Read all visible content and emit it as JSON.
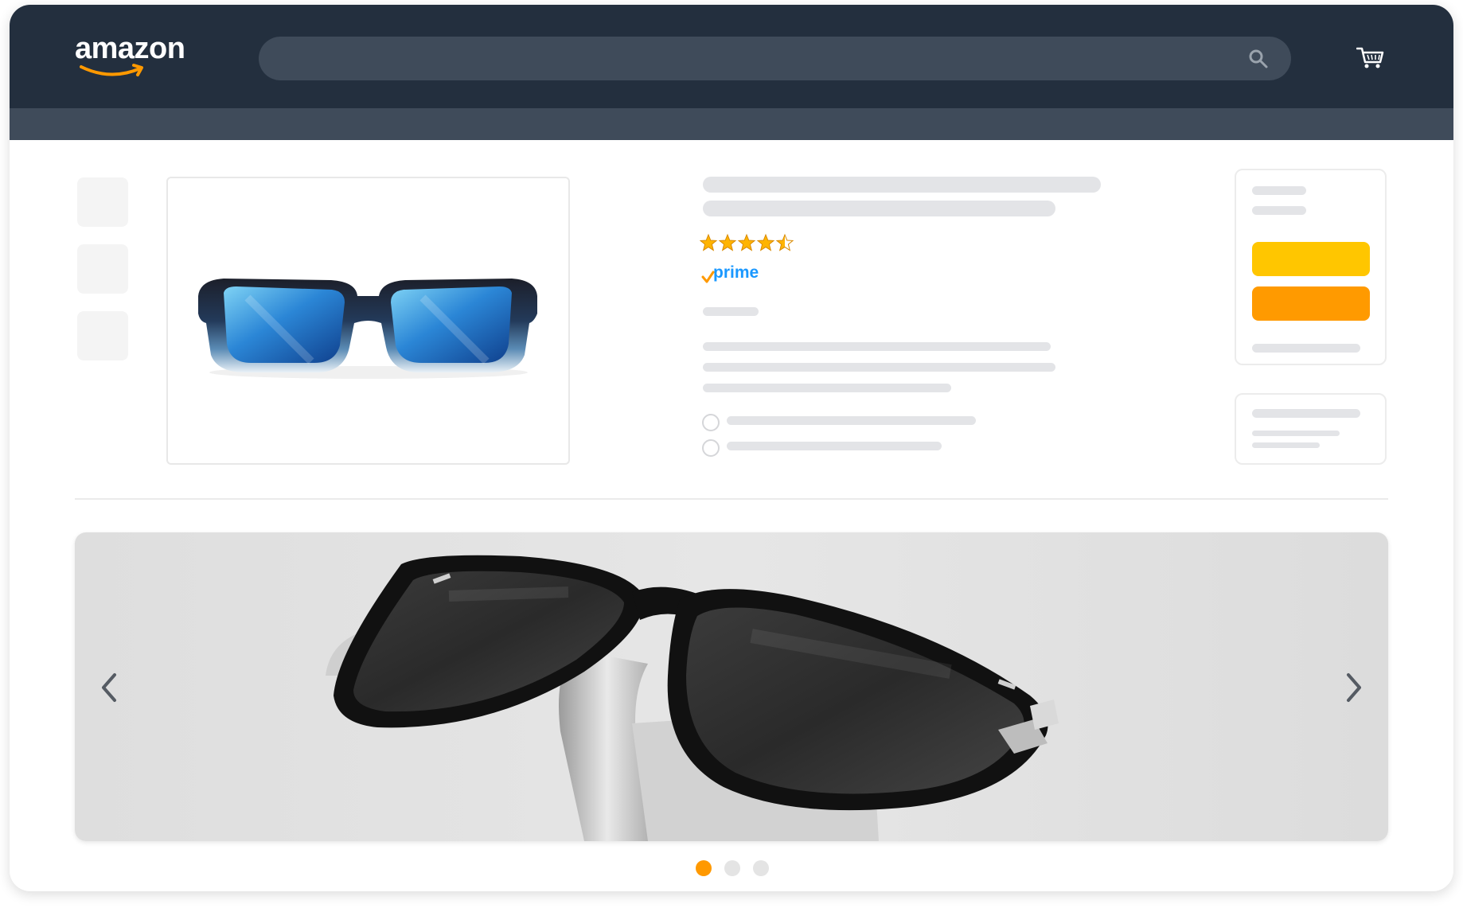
{
  "header": {
    "logo_text": "amazon",
    "logo_smile_color": "#ff9900",
    "bar_color": "#232f3e",
    "search_icon": "search-icon",
    "cart_icon": "cart-icon"
  },
  "product": {
    "image": "blue-mirrored-sunglasses",
    "rating": 4.5,
    "rating_max": 5,
    "star_color": "#ffb400",
    "prime_label": "prime",
    "prime_color": "#00a8e1"
  },
  "buy_box": {
    "add_to_cart_color": "#ffc600",
    "buy_now_color": "#ff9a00"
  },
  "carousel": {
    "image": "black-sunglasses-on-stand",
    "prev_icon": "chevron-left-icon",
    "next_icon": "chevron-right-icon",
    "slides": 3,
    "active_slide": 1,
    "active_dot_color": "#ff9900"
  }
}
